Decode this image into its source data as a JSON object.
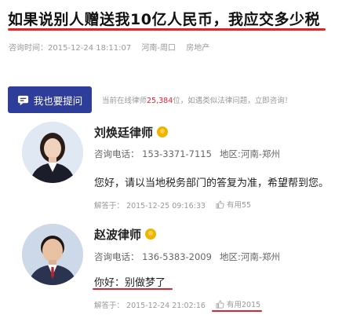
{
  "question": {
    "title": "如果说别人赠送我10亿人民币，我应交多少税",
    "meta": {
      "time_label": "咨询时间：",
      "time": "2015-12-24 18:11:07",
      "location": "河南-周口",
      "category": "房地产"
    }
  },
  "ask_button": {
    "label": "我也要提问"
  },
  "online_notice": {
    "prefix": "当前在线律师",
    "count": "25,384",
    "suffix": "位，如遇类似法律问题，立即咨询！"
  },
  "answers": [
    {
      "name": "刘焕廷律师",
      "phone": "咨询电话：  153-3371-7115",
      "region": "地区:河南-郑州",
      "text": "您好，请以当地税务部门的答复为准，希望帮到您。",
      "time": "解答于：  2015-12-25 09:16:33",
      "useful": "有用55"
    },
    {
      "name": "赵波律师",
      "phone": "咨询电话：  136-5383-2009",
      "region": "地区:河南-郑州",
      "text": "你好：别做梦了",
      "time": "解答于：  2015-12-24 21:02:16",
      "useful": "有用2015"
    }
  ],
  "colors": {
    "accent": "#e0242c",
    "button": "#2f3d9a"
  }
}
